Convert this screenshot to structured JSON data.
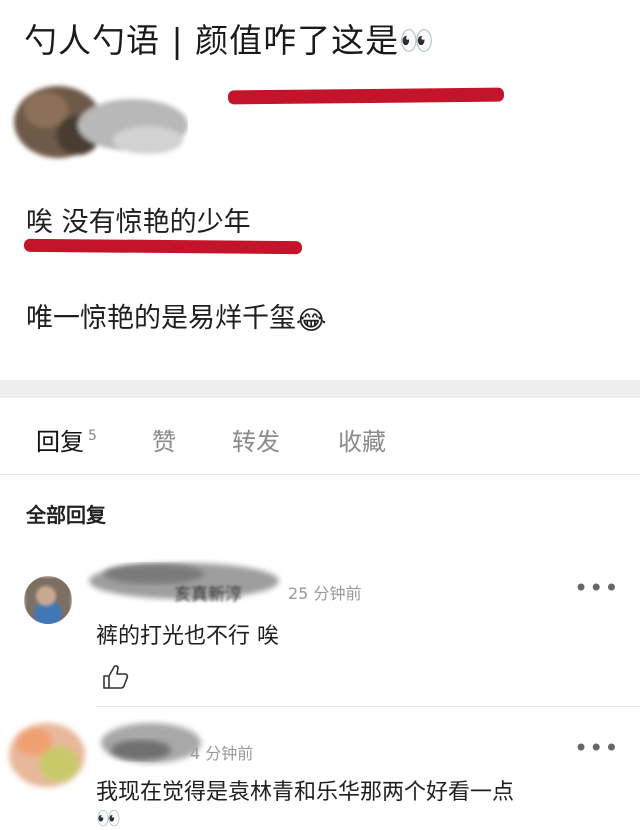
{
  "post": {
    "title_text": "勺人勺语 | 颜值咋了这是",
    "title_emoji": "👀",
    "line1": "唉  没有惊艳的少年",
    "line2_text": "唯一惊艳的是易烊千玺",
    "line2_emoji": "😂"
  },
  "tabs": [
    {
      "label": "回复",
      "count": "5"
    },
    {
      "label": "赞"
    },
    {
      "label": "转发"
    },
    {
      "label": "收藏"
    }
  ],
  "section_label": "全部回复",
  "comments": [
    {
      "name": "亥真新淳",
      "time": "25 分钟前",
      "text": "裤的打光也不行 唉",
      "more": "•••"
    },
    {
      "time": "4 分钟前",
      "text": "我现在觉得是袁林青和乐华那两个好看一点",
      "emoji": "👀",
      "more": "•••"
    }
  ],
  "colors": {
    "red_underline": "#c4142b",
    "section_band": "#eeeeee"
  }
}
